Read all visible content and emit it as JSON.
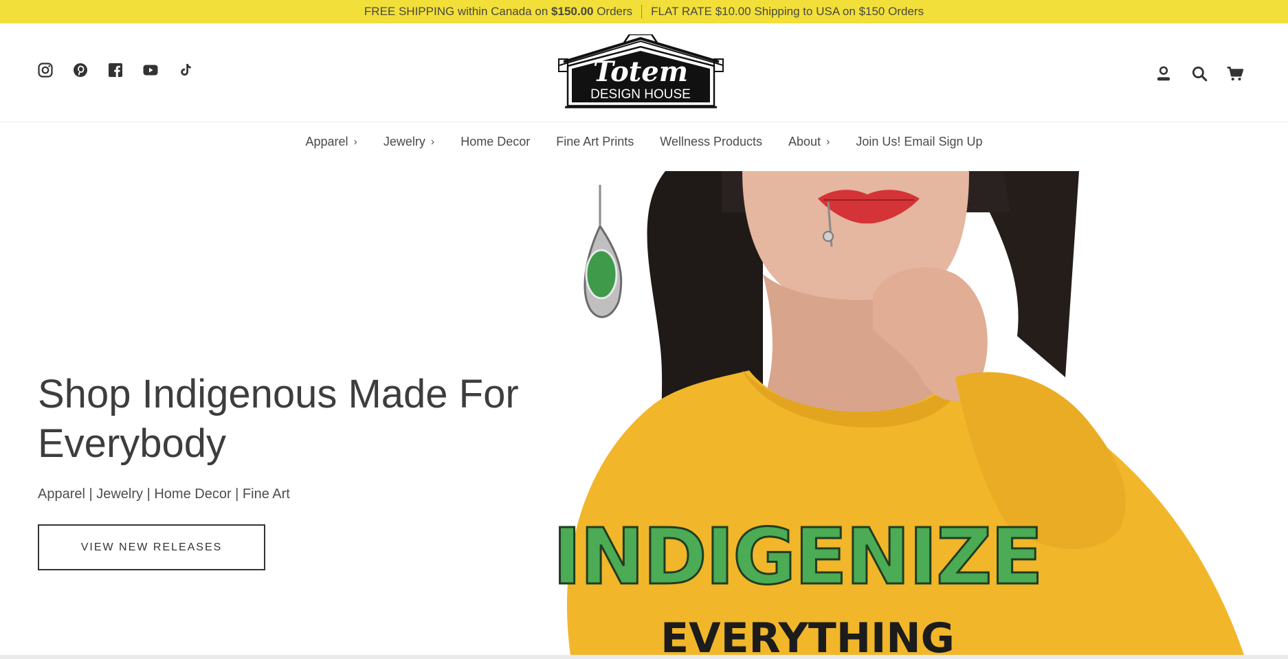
{
  "announcement": {
    "left_text": "FREE SHIPPING within Canada on ",
    "left_amount": "$150.00",
    "left_suffix": " Orders",
    "right_text": "FLAT RATE $10.00  Shipping to USA on $150 Orders"
  },
  "header": {
    "socials": [
      "instagram-icon",
      "pinterest-icon",
      "facebook-icon",
      "youtube-icon",
      "tiktok-icon"
    ],
    "logo": {
      "top_text": "Totem",
      "bottom_text": "DESIGN HOUSE"
    },
    "utilities": [
      "account-icon",
      "search-icon",
      "cart-icon"
    ]
  },
  "nav": {
    "items": [
      {
        "label": "Apparel",
        "chevron": "›"
      },
      {
        "label": "Jewelry",
        "chevron": "›"
      },
      {
        "label": "Home Decor"
      },
      {
        "label": "Fine Art Prints"
      },
      {
        "label": "Wellness Products"
      },
      {
        "label": "About",
        "chevron": "›"
      },
      {
        "label": "Join Us! Email Sign Up"
      }
    ]
  },
  "hero": {
    "title": "Shop Indigenous Made For Everybody",
    "subtitle": "Apparel | Jewelry | Home Decor | Fine Art",
    "button_label": "VIEW NEW RELEASES",
    "image_text_top": "INDIGENIZE",
    "image_text_bottom": "EVERYTHING"
  },
  "colors": {
    "announcement_bg": "#f2df3a",
    "sweater": "#f1b62a",
    "lips": "#d43437"
  }
}
